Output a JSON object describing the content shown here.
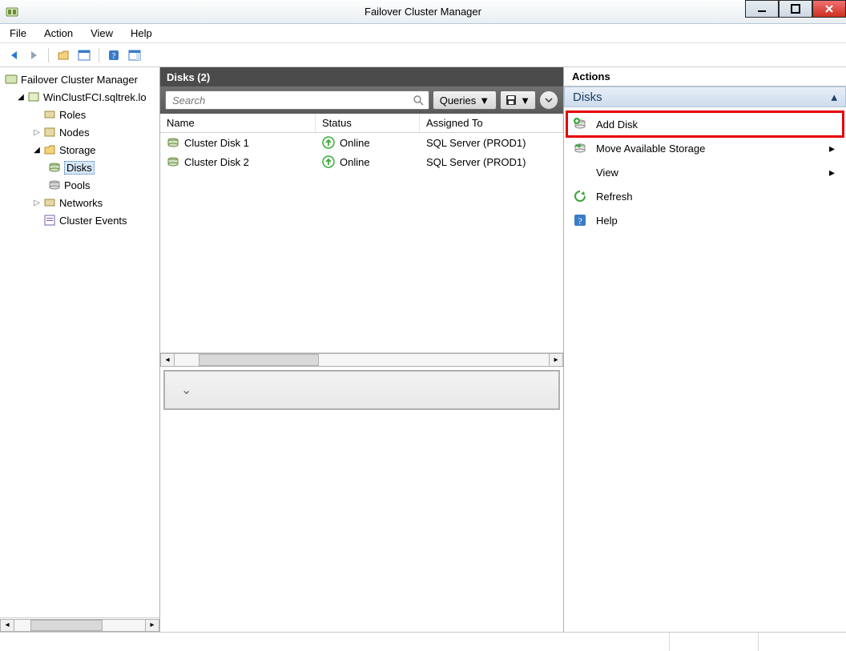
{
  "window": {
    "title": "Failover Cluster Manager"
  },
  "menu": {
    "file": "File",
    "action": "Action",
    "view": "View",
    "help": "Help"
  },
  "tree": {
    "root": "Failover Cluster Manager",
    "cluster": "WinClustFCI.sqltrek.lo",
    "roles": "Roles",
    "nodes": "Nodes",
    "storage": "Storage",
    "disks": "Disks",
    "pools": "Pools",
    "networks": "Networks",
    "cluster_events": "Cluster Events"
  },
  "center": {
    "header": "Disks (2)",
    "search_placeholder": "Search",
    "queries_label": "Queries",
    "columns": {
      "name": "Name",
      "status": "Status",
      "assigned": "Assigned To"
    },
    "rows": [
      {
        "name": "Cluster Disk 1",
        "status": "Online",
        "assigned": "SQL Server (PROD1)"
      },
      {
        "name": "Cluster Disk 2",
        "status": "Online",
        "assigned": "SQL Server (PROD1)"
      }
    ]
  },
  "actions": {
    "title": "Actions",
    "section": "Disks",
    "items": [
      {
        "label": "Add Disk",
        "icon": "add-disk",
        "highlight": true
      },
      {
        "label": "Move Available Storage",
        "icon": "move-storage",
        "submenu": true
      },
      {
        "label": "View",
        "icon": "none",
        "submenu": true
      },
      {
        "label": "Refresh",
        "icon": "refresh"
      },
      {
        "label": "Help",
        "icon": "help"
      }
    ]
  }
}
